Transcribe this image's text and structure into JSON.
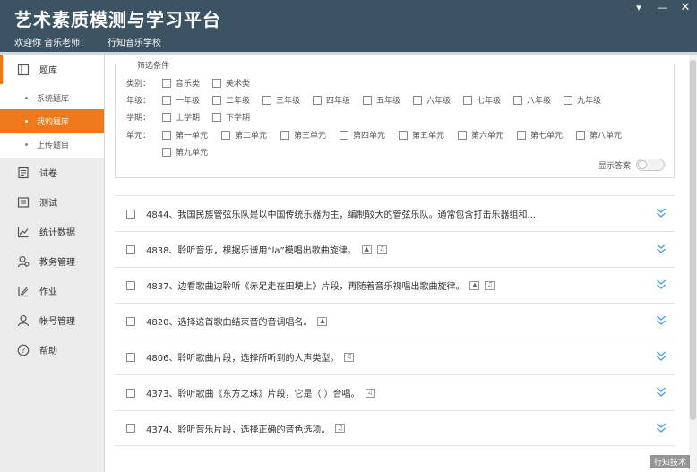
{
  "header": {
    "title": "艺术素质模测与学习平台",
    "welcome": "欢迎你 音乐老师！",
    "school": "行知音乐学校",
    "window_controls": {
      "menu": "▾",
      "minimize": "—",
      "close": "✕"
    }
  },
  "sidebar": {
    "items": [
      {
        "label": "题库",
        "icon": "book-icon",
        "active": true
      },
      {
        "label": "试卷",
        "icon": "paper-icon"
      },
      {
        "label": "测试",
        "icon": "test-icon"
      },
      {
        "label": "统计数据",
        "icon": "chart-icon"
      },
      {
        "label": "教务管理",
        "icon": "user-admin-icon"
      },
      {
        "label": "作业",
        "icon": "homework-icon"
      },
      {
        "label": "帐号管理",
        "icon": "account-icon"
      },
      {
        "label": "帮助",
        "icon": "help-icon"
      }
    ],
    "subitems": [
      {
        "label": "系统题库"
      },
      {
        "label": "我的题库",
        "active": true
      },
      {
        "label": "上传题目"
      }
    ]
  },
  "filter": {
    "legend": "筛选条件",
    "category": {
      "label": "类别：",
      "options": [
        "音乐类",
        "美术类"
      ]
    },
    "grade": {
      "label": "年级：",
      "options": [
        "一年级",
        "二年级",
        "三年级",
        "四年级",
        "五年级",
        "六年级",
        "七年级",
        "八年级",
        "九年级"
      ]
    },
    "term": {
      "label": "学期：",
      "options": [
        "上学期",
        "下学期"
      ]
    },
    "unit": {
      "label": "单元：",
      "options": [
        "第一单元",
        "第二单元",
        "第三单元",
        "第四单元",
        "第五单元",
        "第六单元",
        "第七单元",
        "第八单元",
        "第九单元"
      ]
    },
    "show_answer_label": "显示答案"
  },
  "questions": [
    {
      "text": "4844、我国民族管弦乐队是以中国传统乐器为主，编制较大的管弦乐队。通常包含打击乐器组和...",
      "media": []
    },
    {
      "text": "4838、聆听音乐，根据乐谱用“la”模唱出歌曲旋律。",
      "media": [
        "image",
        "audio"
      ]
    },
    {
      "text": "4837、边看歌曲边聆听《赤足走在田埂上》片段，再随着音乐视唱出歌曲旋律。",
      "media": [
        "image",
        "audio"
      ]
    },
    {
      "text": "4820、选择这首歌曲结束音的音调唱名。",
      "media": [
        "image"
      ]
    },
    {
      "text": "4806、聆听歌曲片段，选择所听到的人声类型。",
      "media": [
        "audio"
      ]
    },
    {
      "text": "4373、聆听歌曲《东方之珠》片段，它是（ ）合唱。",
      "media": [
        "audio"
      ]
    },
    {
      "text": "4374、聆听音乐片段，选择正确的音色选项。",
      "media": [
        "audio"
      ]
    }
  ],
  "watermark": "行知技术",
  "colors": {
    "header": "#3b5362",
    "accent": "#f07818",
    "expand": "#4a9fe0"
  }
}
